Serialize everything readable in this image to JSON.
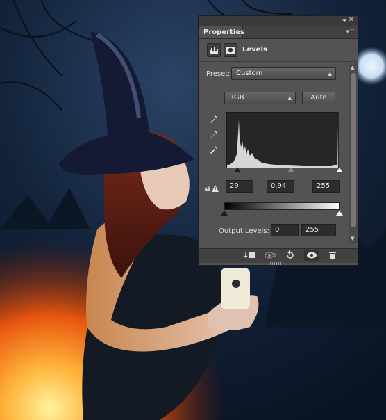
{
  "panel": {
    "tab_label": "Properties",
    "adjustment_title": "Levels",
    "preset_label": "Preset:",
    "preset_value": "Custom",
    "channel_value": "RGB",
    "auto_label": "Auto",
    "input_black": "29",
    "input_gamma": "0.94",
    "input_white": "255",
    "output_label": "Output Levels:",
    "output_black": "0",
    "output_white": "255"
  },
  "colors": {
    "panel_bg": "#535353",
    "sky_night": "#0d1a2c",
    "fire": "#ff8a1e"
  },
  "icons": {
    "adjustment": "histogram-icon",
    "mask": "mask-icon",
    "collapse": "double-chevron-icon",
    "menu": "panel-menu-icon",
    "eyedroppers": [
      "black-eyedropper-icon",
      "gray-eyedropper-icon",
      "white-eyedropper-icon"
    ],
    "warning": "clipping-warning-icon",
    "bottom": [
      "clip-to-layer-icon",
      "view-previous-icon",
      "reset-icon",
      "visibility-eye-icon",
      "trash-icon"
    ]
  }
}
